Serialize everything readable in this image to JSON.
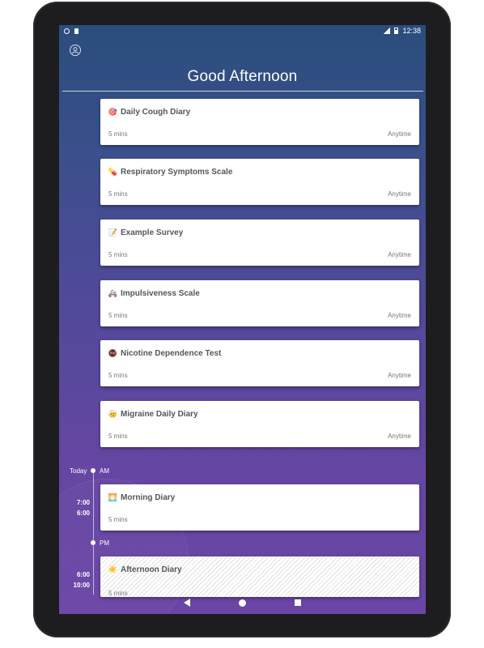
{
  "status_bar": {
    "time": "12:38"
  },
  "header": {
    "greeting": "Good Afternoon"
  },
  "surveys": [
    {
      "emoji": "🎯",
      "emoji_name": "target-icon",
      "title": "Daily Cough Diary",
      "duration": "5 mins",
      "time": "Anytime"
    },
    {
      "emoji": "💊",
      "emoji_name": "pill-icon",
      "title": "Respiratory Symptoms Scale",
      "duration": "5 mins",
      "time": "Anytime"
    },
    {
      "emoji": "📝",
      "emoji_name": "memo-icon",
      "title": "Example Survey",
      "duration": "5 mins",
      "time": "Anytime"
    },
    {
      "emoji": "🚑",
      "emoji_name": "ambulance-icon",
      "title": "Impulsiveness Scale",
      "duration": "5 mins",
      "time": "Anytime"
    },
    {
      "emoji": "🚭",
      "emoji_name": "no-smoking-icon",
      "title": "Nicotine Dependence Test",
      "duration": "5 mins",
      "time": "Anytime"
    },
    {
      "emoji": "🤕",
      "emoji_name": "head-bandage-icon",
      "title": "Migraine Daily Diary",
      "duration": "5 mins",
      "time": "Anytime"
    }
  ],
  "timeline": {
    "today_label": "Today",
    "am_label": "AM",
    "pm_label": "PM",
    "scheduled": [
      {
        "emoji": "🌅",
        "emoji_name": "sunrise-icon",
        "title": "Morning Diary",
        "duration": "5 mins",
        "start": "7:00",
        "end": "6:00"
      },
      {
        "emoji": "☀️",
        "emoji_name": "sun-icon",
        "title": "Afternoon Diary",
        "duration": "5 mins",
        "start": "6:00",
        "end": "10:00"
      }
    ]
  }
}
